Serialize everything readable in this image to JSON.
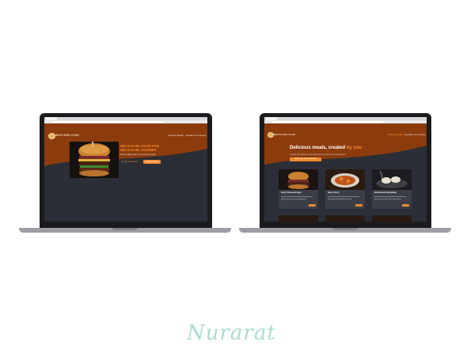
{
  "colors": {
    "accent": "#f28a2a",
    "header_brown": "#8b3b0c",
    "page_dark": "#2b2e36",
    "signature_mint": "#a9ddd0"
  },
  "left_site": {
    "brand": "NEXTLEVEL FOOD",
    "nav": [
      "Browse Meals",
      "Foodies Community"
    ],
    "headline_line1": "NEXTLEVEL FOOD FOR",
    "headline_line2": "NEXTLEVEL FOODIES",
    "subtext": "Taste & share food from all over the world.",
    "link_label": "Join the Community",
    "cta_label": "Explore Meals"
  },
  "right_site": {
    "brand": "NEXTLEVEL FOOD",
    "nav": [
      "Browse Meals",
      "Foodies Community"
    ],
    "heading_main": "Delicious meals, created ",
    "heading_accent": "by you",
    "subtext": "Choose your favorite recipe and cook it yourself. It is easy and fun!",
    "cta_label": "Share Your Favorite Recipe",
    "cards": [
      {
        "title": "Juicy Cheese Burger"
      },
      {
        "title": "Spicy Curry"
      },
      {
        "title": "Homemade Dumplings"
      }
    ]
  },
  "signature_text": "Nurarat"
}
